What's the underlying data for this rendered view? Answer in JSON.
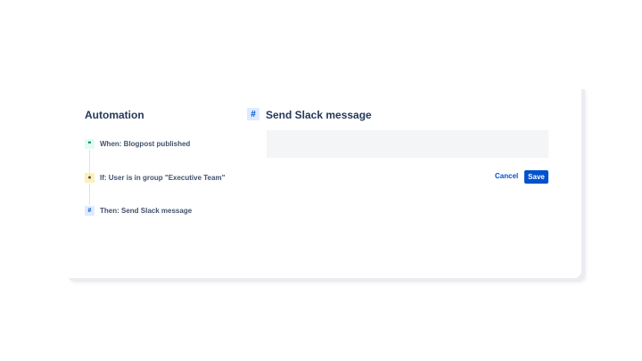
{
  "sidebar": {
    "title": "Automation",
    "steps": [
      {
        "label": "When: Blogpost published",
        "icon": "quote-icon",
        "glyph": "❞",
        "color": "#00875a",
        "bg": "#e3fcef"
      },
      {
        "label": "If: User is in group \"Executive Team\"",
        "icon": "user-icon",
        "glyph": "●",
        "color": "#42526e",
        "bg": "#fff0b3"
      },
      {
        "label": "Then: Send Slack message",
        "icon": "slack-icon",
        "glyph": "#",
        "color": "#0052cc",
        "bg": "#deebff"
      }
    ]
  },
  "editor": {
    "title": "Send Slack message",
    "message_value": "",
    "cancel_label": "Cancel",
    "save_label": "Save"
  },
  "colors": {
    "accent": "#0052cc"
  }
}
